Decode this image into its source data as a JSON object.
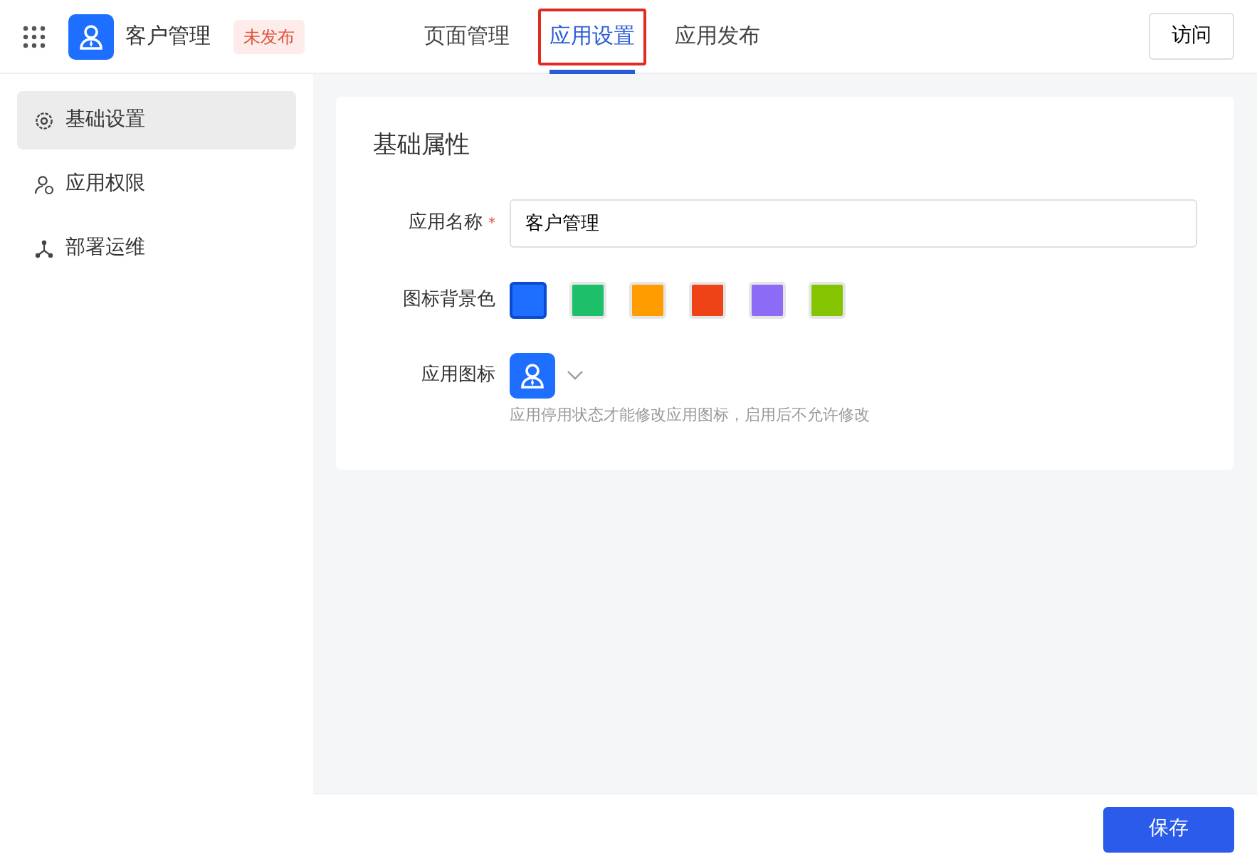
{
  "app": {
    "name": "客户管理",
    "status": "未发布"
  },
  "tabs": [
    {
      "label": "页面管理",
      "selected": false,
      "highlighted": false
    },
    {
      "label": "应用设置",
      "selected": true,
      "highlighted": true
    },
    {
      "label": "应用发布",
      "selected": false,
      "highlighted": false
    }
  ],
  "visit_button": "访问",
  "sidebar": {
    "items": [
      {
        "label": "基础设置",
        "kind": "general",
        "selected": true
      },
      {
        "label": "应用权限",
        "kind": "permissions",
        "selected": false
      },
      {
        "label": "部署运维",
        "kind": "deployment",
        "selected": false
      }
    ]
  },
  "form": {
    "title": "基础属性",
    "name_field": {
      "label": "应用名称",
      "required_mark": "*",
      "value": "客户管理"
    },
    "colors": {
      "label": "图标背景色",
      "options": [
        {
          "color": "#1e6fff",
          "selected": true
        },
        {
          "color": "#1dbf6b",
          "selected": false
        },
        {
          "color": "#ff9c00",
          "selected": false
        },
        {
          "color": "#ee4316",
          "selected": false
        },
        {
          "color": "#8c6cf7",
          "selected": false
        },
        {
          "color": "#85c400",
          "selected": false
        }
      ]
    },
    "icon_field": {
      "label": "应用图标",
      "hint": "应用停用状态才能修改应用图标，启用后不允许修改"
    }
  },
  "save_button": "保存"
}
